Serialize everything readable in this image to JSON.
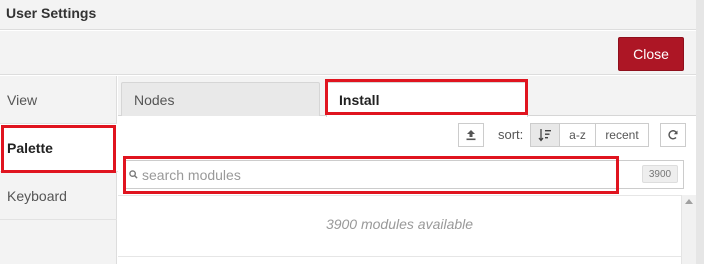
{
  "dialog": {
    "title": "User Settings",
    "close_label": "Close"
  },
  "sidebar": {
    "items": [
      {
        "label": "View",
        "active": false
      },
      {
        "label": "Palette",
        "active": true
      },
      {
        "label": "Keyboard",
        "active": false
      }
    ]
  },
  "tabs": [
    {
      "label": "Nodes",
      "active": false
    },
    {
      "label": "Install",
      "active": true
    }
  ],
  "toolbar": {
    "upload_icon": "upload-icon",
    "sort_label": "sort:",
    "sort_options": [
      {
        "icon": "sort-relevance-icon",
        "selected": true
      },
      {
        "label": "a-z",
        "selected": false
      },
      {
        "label": "recent",
        "selected": false
      }
    ],
    "refresh_icon": "refresh-icon"
  },
  "search": {
    "placeholder": "search modules",
    "value": "",
    "count": "3900"
  },
  "list": {
    "status": "3900 modules available"
  },
  "colors": {
    "close_button": "#ad1625",
    "highlight": "#e0141f",
    "panel": "#f3f3f3"
  }
}
